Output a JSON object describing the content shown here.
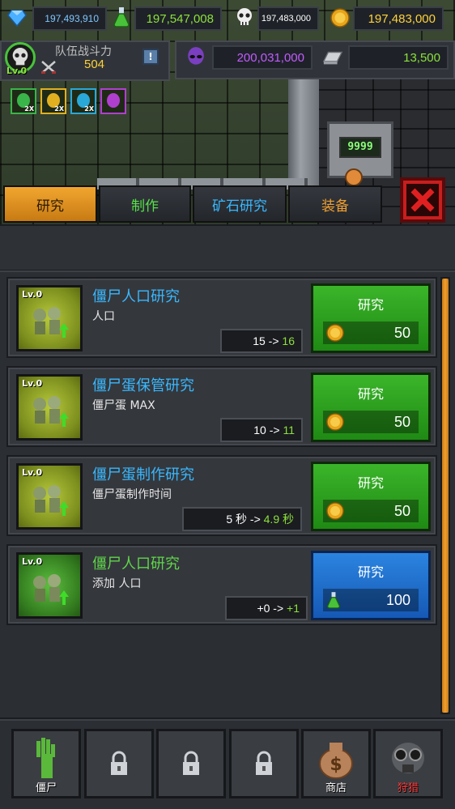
{
  "resources": {
    "gems": "197,493,910",
    "potions": "197,547,008",
    "skulls": "197,483,000",
    "coins": "197,483,000",
    "alien": "200,031,000",
    "ingots": "13,500"
  },
  "team": {
    "level": "Lv.0",
    "label": "队伍战斗力",
    "power": "504",
    "info_icon": "!"
  },
  "boosts": [
    {
      "icon": "potion-2x-icon",
      "text": "2X",
      "color": "#39b54a"
    },
    {
      "icon": "coin-2x-icon",
      "text": "2X",
      "color": "#e0b020"
    },
    {
      "icon": "gold-2x-icon",
      "text": "2X",
      "color": "#2aa8d8"
    },
    {
      "icon": "zombie-boost-icon",
      "text": "",
      "color": "#b03fd0"
    }
  ],
  "scene": {
    "machine_display": "9999"
  },
  "tabs": [
    {
      "label": "研究",
      "color": "#2a1a06"
    },
    {
      "label": "制作",
      "color": "#58e04a"
    },
    {
      "label": "矿石研究",
      "color": "#39b8ff"
    },
    {
      "label": "装备",
      "color": "#f0a030"
    }
  ],
  "research": [
    {
      "level": "Lv.0",
      "title": "僵尸人口研究",
      "desc": "人口",
      "from": "15 ->",
      "to": "16",
      "btn": "研究",
      "cost": "50",
      "cost_type": "coin",
      "style": "yellow"
    },
    {
      "level": "Lv.0",
      "title": "僵尸蛋保管研究",
      "desc": "僵尸蛋 MAX",
      "from": "10 ->",
      "to": "11",
      "btn": "研究",
      "cost": "50",
      "cost_type": "coin",
      "style": "yellow"
    },
    {
      "level": "Lv.0",
      "title": "僵尸蛋制作研究",
      "desc": "僵尸蛋制作时间",
      "from": "5 秒 ->",
      "to": "4.9 秒",
      "btn": "研究",
      "cost": "50",
      "cost_type": "coin",
      "style": "yellow"
    },
    {
      "level": "Lv.0",
      "title": "僵尸人口研究",
      "desc": "添加 人口",
      "from": "+0 ->",
      "to": "+1",
      "btn": "研究",
      "cost": "100",
      "cost_type": "potion",
      "style": "green"
    }
  ],
  "nav": [
    {
      "label": "僵尸",
      "icon": "zombie-hand-icon",
      "locked": false,
      "color": "#ffffff"
    },
    {
      "label": "",
      "icon": "lock-icon",
      "locked": true
    },
    {
      "label": "",
      "icon": "lock-icon",
      "locked": true
    },
    {
      "label": "",
      "icon": "lock-icon",
      "locked": true
    },
    {
      "label": "商店",
      "icon": "money-bag-icon",
      "locked": false,
      "color": "#ffffff"
    },
    {
      "label": "狩猎",
      "icon": "gas-mask-icon",
      "locked": false,
      "color": "#ff3a3a"
    }
  ]
}
